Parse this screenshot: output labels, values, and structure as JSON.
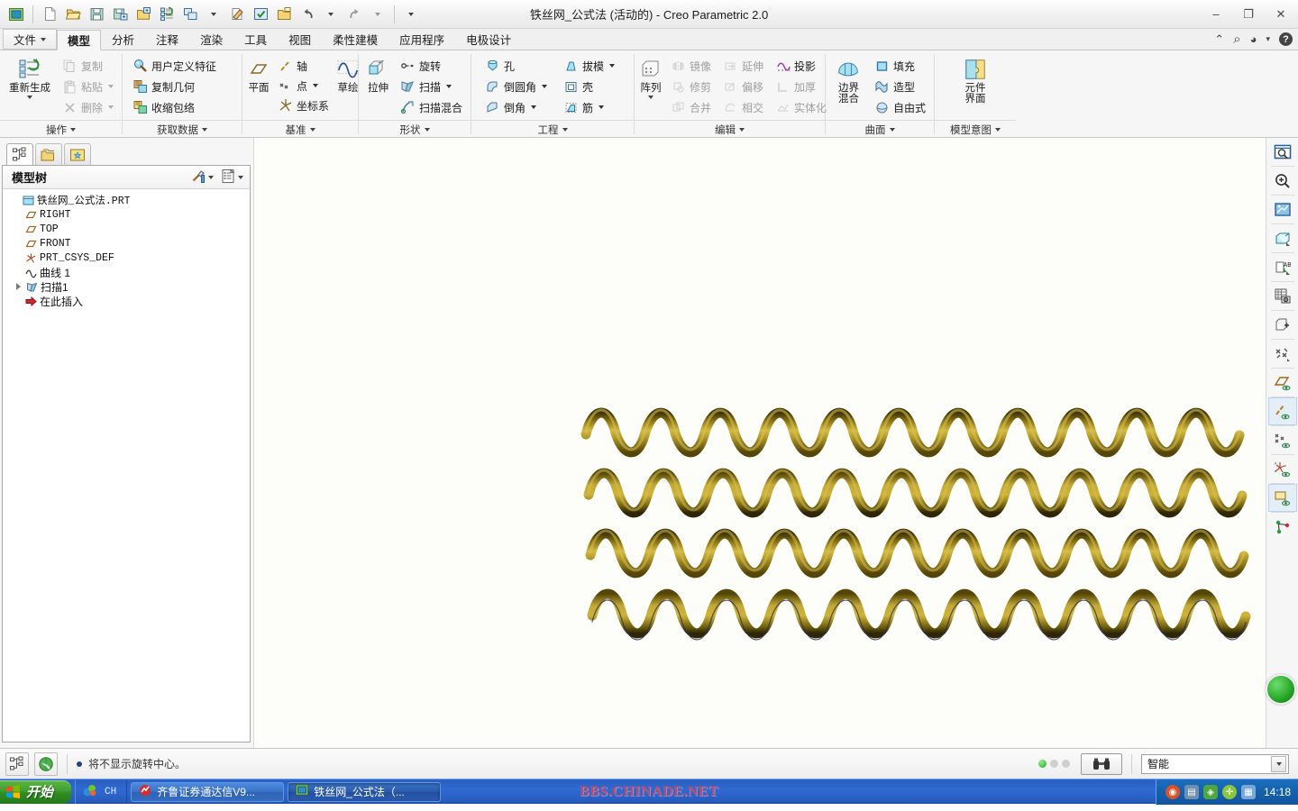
{
  "window": {
    "title": "铁丝网_公式法 (活动的) - Creo Parametric 2.0",
    "minimize": "–",
    "maximize": "❐",
    "close": "✕"
  },
  "quick_access": [
    {
      "name": "app-icon",
      "icon": "creo-window-icon"
    },
    {
      "name": "new-button",
      "icon": "new-file-icon"
    },
    {
      "name": "open-button",
      "icon": "open-folder-icon"
    },
    {
      "name": "save-button",
      "icon": "save-disk-icon"
    },
    {
      "name": "save-as-button",
      "icon": "save-as-icon"
    },
    {
      "name": "save-copy-button",
      "icon": "save-copy-icon"
    },
    {
      "name": "regenerate-button",
      "icon": "regenerate-list-icon"
    },
    {
      "name": "window-list-button",
      "icon": "window-tile-icon"
    },
    {
      "name": "erase-button",
      "icon": "erase-icon"
    },
    {
      "name": "select-button",
      "icon": "checkbox-window-icon"
    },
    {
      "name": "close-window-button",
      "icon": "close-folder-icon"
    },
    {
      "name": "undo-button",
      "icon": "undo-arrow-icon"
    },
    {
      "name": "redo-button",
      "icon": "redo-arrow-icon"
    },
    {
      "name": "customize-button",
      "icon": "chevron-down-icon"
    }
  ],
  "tabs": [
    {
      "label": "文件",
      "active": false,
      "is_file": true
    },
    {
      "label": "模型",
      "active": true
    },
    {
      "label": "分析",
      "active": false
    },
    {
      "label": "注释",
      "active": false
    },
    {
      "label": "渲染",
      "active": false
    },
    {
      "label": "工具",
      "active": false
    },
    {
      "label": "视图",
      "active": false
    },
    {
      "label": "柔性建模",
      "active": false
    },
    {
      "label": "应用程序",
      "active": false
    },
    {
      "label": "电极设计",
      "active": false
    }
  ],
  "help_zone": [
    {
      "name": "collapse-ribbon-icon",
      "glyph": "⌃"
    },
    {
      "name": "search-icon",
      "glyph": "⌕"
    },
    {
      "name": "help-center-icon",
      "glyph": "◕"
    },
    {
      "name": "help-dropdown-icon",
      "glyph": "▾"
    },
    {
      "name": "help-icon",
      "glyph": "?"
    }
  ],
  "ribbon": {
    "groups": [
      {
        "title": "操作",
        "big": {
          "label": "重新生成",
          "icon": "regenerate-icon",
          "has_arrow": true
        },
        "items": [
          {
            "label": "复制",
            "icon": "copy-icon",
            "disabled": true,
            "arrow": false
          },
          {
            "label": "粘贴",
            "icon": "paste-icon",
            "disabled": true,
            "arrow": true
          },
          {
            "label": "删除",
            "icon": "delete-x-icon",
            "disabled": true,
            "arrow": true
          }
        ]
      },
      {
        "title": "获取数据",
        "items": [
          {
            "label": "用户定义特征",
            "icon": "udf-icon",
            "disabled": false,
            "arrow": false
          },
          {
            "label": "复制几何",
            "icon": "copy-geometry-icon",
            "disabled": false,
            "arrow": false
          },
          {
            "label": "收缩包络",
            "icon": "shrinkwrap-icon",
            "disabled": false,
            "arrow": false
          }
        ]
      },
      {
        "title": "基准",
        "big": {
          "label": "平面",
          "icon": "datum-plane-icon",
          "has_arrow": false
        },
        "items": [
          {
            "label": "轴",
            "icon": "datum-axis-icon",
            "disabled": false,
            "arrow": false
          },
          {
            "label": "点",
            "icon": "datum-point-icon",
            "disabled": false,
            "arrow": true
          },
          {
            "label": "坐标系",
            "icon": "datum-csys-icon",
            "disabled": false,
            "arrow": false
          }
        ],
        "big2": {
          "label": "草绘",
          "icon": "sketch-icon",
          "has_arrow": false
        }
      },
      {
        "title": "形状",
        "big": {
          "label": "拉伸",
          "icon": "extrude-icon",
          "has_arrow": false
        },
        "items": [
          {
            "label": "旋转",
            "icon": "revolve-icon",
            "disabled": false,
            "arrow": false
          },
          {
            "label": "扫描",
            "icon": "sweep-icon",
            "disabled": false,
            "arrow": true
          },
          {
            "label": "扫描混合",
            "icon": "swept-blend-icon",
            "disabled": false,
            "arrow": false
          }
        ]
      },
      {
        "title": "工程",
        "items": [
          {
            "label": "孔",
            "icon": "hole-icon",
            "disabled": false,
            "arrow": false
          },
          {
            "label": "倒圆角",
            "icon": "round-icon",
            "disabled": false,
            "arrow": true
          },
          {
            "label": "倒角",
            "icon": "chamfer-icon",
            "disabled": false,
            "arrow": true
          }
        ],
        "items2": [
          {
            "label": "拔模",
            "icon": "draft-icon",
            "disabled": false,
            "arrow": true
          },
          {
            "label": "壳",
            "icon": "shell-icon",
            "disabled": false,
            "arrow": false
          },
          {
            "label": "筋",
            "icon": "rib-icon",
            "disabled": false,
            "arrow": true
          }
        ]
      },
      {
        "title": "编辑",
        "big": {
          "label": "阵列",
          "icon": "pattern-icon",
          "has_arrow": true
        },
        "items": [
          {
            "label": "镜像",
            "icon": "mirror-icon",
            "disabled": true,
            "arrow": false
          },
          {
            "label": "修剪",
            "icon": "trim-icon",
            "disabled": true,
            "arrow": false
          },
          {
            "label": "合并",
            "icon": "merge-icon",
            "disabled": true,
            "arrow": false
          }
        ],
        "items2": [
          {
            "label": "延伸",
            "icon": "extend-icon",
            "disabled": true,
            "arrow": false
          },
          {
            "label": "偏移",
            "icon": "offset-icon",
            "disabled": true,
            "arrow": false
          },
          {
            "label": "相交",
            "icon": "intersect-icon",
            "disabled": true,
            "arrow": false
          }
        ],
        "items3": [
          {
            "label": "投影",
            "icon": "project-icon",
            "disabled": false,
            "arrow": false
          },
          {
            "label": "加厚",
            "icon": "thicken-icon",
            "disabled": true,
            "arrow": false
          },
          {
            "label": "实体化",
            "icon": "solidify-icon",
            "disabled": true,
            "arrow": false
          }
        ]
      },
      {
        "title": "曲面",
        "big": {
          "label": "边界\n混合",
          "icon": "boundary-blend-icon",
          "has_arrow": false
        },
        "items": [
          {
            "label": "填充",
            "icon": "fill-icon",
            "disabled": false,
            "arrow": false
          },
          {
            "label": "造型",
            "icon": "style-icon",
            "disabled": false,
            "arrow": false
          },
          {
            "label": "自由式",
            "icon": "freestyle-icon",
            "disabled": false,
            "arrow": false
          }
        ]
      },
      {
        "title": "模型意图",
        "big": {
          "label": "元件\n界面",
          "icon": "component-interface-icon",
          "has_arrow": false
        }
      }
    ]
  },
  "nav_tabs": [
    {
      "name": "model-tree-tab",
      "icon": "tree-nodes-icon",
      "active": true
    },
    {
      "name": "folder-browser-tab",
      "icon": "folder-stack-icon",
      "active": false
    },
    {
      "name": "favorites-tab",
      "icon": "folder-star-icon",
      "active": false
    }
  ],
  "model_tree": {
    "title": "模型树",
    "tools": [
      {
        "name": "settings-tools-icon",
        "arrow": true
      },
      {
        "name": "tree-filters-icon",
        "arrow": true
      }
    ],
    "nodes": [
      {
        "label": "铁丝网_公式法.PRT",
        "icon": "part-icon",
        "indent": 0,
        "expander": false,
        "mono": true
      },
      {
        "label": "RIGHT",
        "icon": "datum-plane-icon",
        "indent": 1,
        "expander": false,
        "mono": true
      },
      {
        "label": "TOP",
        "icon": "datum-plane-icon",
        "indent": 1,
        "expander": false,
        "mono": true
      },
      {
        "label": "FRONT",
        "icon": "datum-plane-icon",
        "indent": 1,
        "expander": false,
        "mono": true
      },
      {
        "label": "PRT_CSYS_DEF",
        "icon": "datum-csys-icon",
        "indent": 1,
        "expander": false,
        "mono": true
      },
      {
        "label": "曲线 1",
        "icon": "curve-icon",
        "indent": 1,
        "expander": false,
        "mono": false
      },
      {
        "label": "扫描1",
        "icon": "sweep-icon",
        "indent": 1,
        "expander": true,
        "mono": false
      },
      {
        "label": "在此插入",
        "icon": "insert-here-icon",
        "indent": 1,
        "expander": false,
        "mono": false
      }
    ]
  },
  "right_toolbar": [
    {
      "name": "refit-zoom-icon",
      "selected": false
    },
    {
      "name": "zoom-in-icon",
      "selected": false
    },
    {
      "name": "repaint-icon",
      "selected": false
    },
    {
      "name": "display-style-icon",
      "selected": false
    },
    {
      "name": "annotation-display-icon",
      "selected": false
    },
    {
      "name": "saved-views-icon",
      "selected": false
    },
    {
      "name": "view-manager-icon",
      "selected": false
    },
    {
      "name": "datum-display-icon",
      "selected": false
    },
    {
      "name": "plane-display-icon",
      "selected": false
    },
    {
      "name": "axis-display-icon",
      "selected": true
    },
    {
      "name": "point-display-icon",
      "selected": false
    },
    {
      "name": "csys-display-icon",
      "selected": false
    },
    {
      "name": "plane-tag-display-icon",
      "selected": true
    },
    {
      "name": "spin-center-icon",
      "selected": false
    }
  ],
  "viewport": {
    "model_name": "铁丝网_公式法",
    "wire_color_light": "#cdb23a",
    "wire_color_dark": "#6b5a12",
    "background": "#fdfdfa",
    "rows": 4,
    "periods_per_row": 12,
    "spin_indicator": "green-sphere"
  },
  "status_bar": {
    "buttons": [
      {
        "name": "model-tree-toggle",
        "icon": "tree-nodes-icon"
      },
      {
        "name": "browser-toggle",
        "icon": "browser-globe-icon"
      }
    ],
    "message": "将不显示旋转中心。",
    "leds": [
      true,
      false,
      false
    ],
    "search_button_icon": "binoculars-icon",
    "filter_value": "智能",
    "filter_arrow": "▼"
  },
  "taskbar": {
    "start_label": "开始",
    "ime_label": "CH",
    "quick_launch_icon": "msn-messenger-icon",
    "items": [
      {
        "label": "齐鲁证券通达信V9...",
        "icon": "stock-app-icon",
        "active": false
      },
      {
        "label": "铁丝网_公式法（...",
        "icon": "creo-window-icon",
        "active": true
      }
    ],
    "watermark": "BBS.CHINADE.NET",
    "tray_icons": [
      {
        "name": "safari-tray-icon",
        "color": "#d9542b"
      },
      {
        "name": "network-tray-icon",
        "color": "#6f8fae"
      },
      {
        "name": "shield-tray-icon",
        "color": "#4fa83d"
      },
      {
        "name": "plus-tray-icon",
        "color": "#8cc63f"
      },
      {
        "name": "monitor-tray-icon",
        "color": "#7ba7d7"
      }
    ],
    "clock": "14:18"
  }
}
